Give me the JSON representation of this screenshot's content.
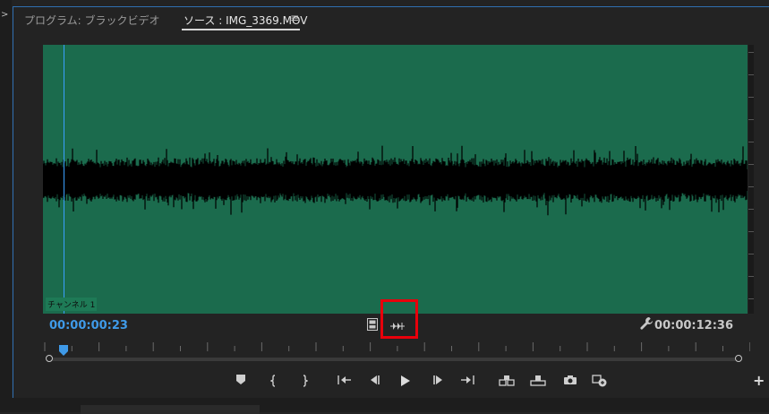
{
  "tabs": {
    "program_label": "プログラム: ブラックビデオ",
    "source_label": "ソース : IMG_3369.MOV",
    "menu_icon": "≡"
  },
  "waveform": {
    "channel_label": "チャンネル 1",
    "background_color": "#1b6b4d",
    "wave_color": "#000000"
  },
  "timecode": {
    "current": "00:00:00:23",
    "duration": "00:00:12:36",
    "current_color": "#3f9ae8"
  },
  "toggles": {
    "video_only": "film-icon",
    "audio_only": "audio-waveform-icon"
  },
  "highlight_color": "#e8000b",
  "controls": [
    {
      "name": "add-marker-button",
      "icon": "marker-icon"
    },
    {
      "name": "mark-in-button",
      "icon": "mark-in-icon"
    },
    {
      "name": "mark-out-button",
      "icon": "mark-out-icon"
    },
    {
      "name": "go-to-in-button",
      "icon": "go-to-in-icon"
    },
    {
      "name": "step-back-button",
      "icon": "step-back-icon"
    },
    {
      "name": "play-button",
      "icon": "play-icon"
    },
    {
      "name": "step-forward-button",
      "icon": "step-forward-icon"
    },
    {
      "name": "go-to-out-button",
      "icon": "go-to-out-icon"
    },
    {
      "name": "insert-button",
      "icon": "insert-icon"
    },
    {
      "name": "overwrite-button",
      "icon": "overwrite-icon"
    },
    {
      "name": "export-frame-button",
      "icon": "camera-icon"
    },
    {
      "name": "button-editor-button",
      "icon": "button-editor-icon"
    }
  ],
  "add_button": "+"
}
